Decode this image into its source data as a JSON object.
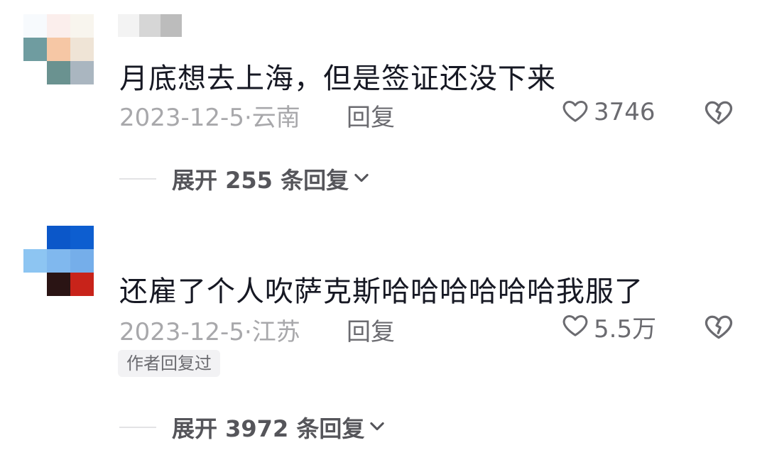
{
  "comments": [
    {
      "text": "月底想去上海，但是签证还没下来",
      "date": "2023-12-5",
      "location": "云南",
      "reply_label": "回复",
      "likes": "3746",
      "expand_label": "展开 255 条回复",
      "avatar_colors": [
        "#f7fafd",
        "#fbeeec",
        "#f8f5ee",
        "#6f9ca0",
        "#f6c7a5",
        "#efe4d6",
        "#ffffff",
        "#6a9290",
        "#aab6c0"
      ],
      "name_colors": [
        "#f3f3f3",
        "#d6d6d6",
        "#bcbcbc"
      ]
    },
    {
      "text": "还雇了个人吹萨克斯哈哈哈哈哈哈我服了",
      "date": "2023-12-5",
      "location": "江苏",
      "reply_label": "回复",
      "likes": "5.5万",
      "author_badge": "作者回复过",
      "expand_label": "展开 3972 条回复",
      "avatar_colors": [
        "#ffffff",
        "#0b57c9",
        "#0d5ed0",
        "#8dc5f2",
        "#80b8ee",
        "#75aeea",
        "#ffffff",
        "#2a1414",
        "#c8231a"
      ]
    }
  ],
  "icons": {
    "like": "heart-outline-icon",
    "dislike": "broken-heart-icon",
    "expand": "chevron-down-icon"
  }
}
